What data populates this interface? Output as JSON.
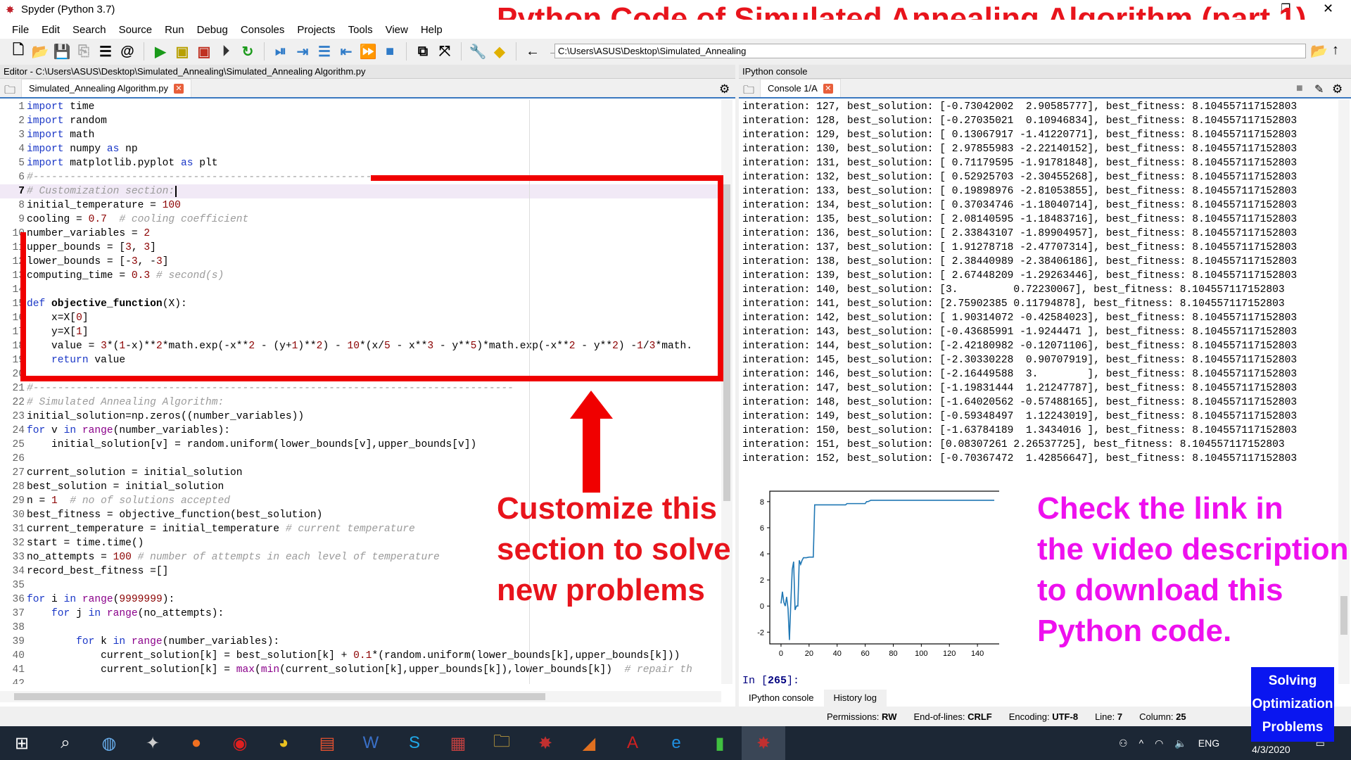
{
  "window": {
    "title": "Spyder (Python 3.7)"
  },
  "overlay": {
    "headline": "Python Code of Simulated Annealing Algorithm (part 1)",
    "customize_lines": [
      "Customize this",
      "section to solve",
      "new problems"
    ],
    "link_lines": [
      "Check the link in",
      "the video description",
      "to download this",
      "Python code."
    ],
    "badge_lines": [
      "Solving",
      "Optimization",
      "Problems"
    ],
    "colors": {
      "red": "#e8141c",
      "magenta": "#ee10ee",
      "badge": "#0a16f0"
    }
  },
  "menu": [
    "File",
    "Edit",
    "Search",
    "Source",
    "Run",
    "Debug",
    "Consoles",
    "Projects",
    "Tools",
    "View",
    "Help"
  ],
  "toolbar": {
    "path": "C:\\Users\\ASUS\\Desktop\\Simulated_Annealing"
  },
  "editor": {
    "header": "Editor - C:\\Users\\ASUS\\Desktop\\Simulated_Annealing\\Simulated_Annealing Algorithm.py",
    "tab": "Simulated_Annealing Algorithm.py",
    "current_line": 7,
    "lines": [
      [
        [
          "import",
          "k"
        ],
        [
          " time",
          ""
        ]
      ],
      [
        [
          "import",
          "k"
        ],
        [
          " random",
          ""
        ]
      ],
      [
        [
          "import",
          "k"
        ],
        [
          " math",
          ""
        ]
      ],
      [
        [
          "import",
          "k"
        ],
        [
          " numpy ",
          ""
        ],
        [
          "as",
          "k"
        ],
        [
          " np",
          ""
        ]
      ],
      [
        [
          "import",
          "k"
        ],
        [
          " matplotlib.pyplot ",
          ""
        ],
        [
          "as",
          "k"
        ],
        [
          " plt",
          ""
        ]
      ],
      [
        [
          "#------------------------------------------------------------------------------",
          "c"
        ]
      ],
      [
        [
          "# Customization section:",
          "c"
        ]
      ],
      [
        [
          "initial_temperature = ",
          ""
        ],
        [
          "100",
          "n"
        ]
      ],
      [
        [
          "cooling = ",
          ""
        ],
        [
          "0.7",
          "n"
        ],
        [
          "  # cooling coefficient",
          "c"
        ]
      ],
      [
        [
          "number_variables = ",
          ""
        ],
        [
          "2",
          "n"
        ]
      ],
      [
        [
          "upper_bounds = [",
          ""
        ],
        [
          "3",
          "n"
        ],
        [
          ", ",
          ""
        ],
        [
          "3",
          "n"
        ],
        [
          "]",
          ""
        ]
      ],
      [
        [
          "lower_bounds = [-",
          ""
        ],
        [
          "3",
          "n"
        ],
        [
          ", -",
          ""
        ],
        [
          "3",
          "n"
        ],
        [
          "]",
          ""
        ]
      ],
      [
        [
          "computing_time = ",
          ""
        ],
        [
          "0.3",
          "n"
        ],
        [
          " # second(s)",
          "c"
        ]
      ],
      [],
      [
        [
          "def",
          "k"
        ],
        [
          " ",
          ""
        ],
        [
          "objective_function",
          "f"
        ],
        [
          "(X):",
          ""
        ]
      ],
      [
        [
          "    x=X[",
          ""
        ],
        [
          "0",
          "n"
        ],
        [
          "]",
          ""
        ]
      ],
      [
        [
          "    y=X[",
          ""
        ],
        [
          "1",
          "n"
        ],
        [
          "]",
          ""
        ]
      ],
      [
        [
          "    value = ",
          ""
        ],
        [
          "3",
          "n"
        ],
        [
          "*(",
          ""
        ],
        [
          "1",
          "n"
        ],
        [
          "-x)**",
          ""
        ],
        [
          "2",
          "n"
        ],
        [
          "*math.exp(-x**",
          ""
        ],
        [
          "2",
          "n"
        ],
        [
          " - (y+",
          ""
        ],
        [
          "1",
          "n"
        ],
        [
          ")**",
          ""
        ],
        [
          "2",
          "n"
        ],
        [
          ") - ",
          ""
        ],
        [
          "10",
          "n"
        ],
        [
          "*(x/",
          ""
        ],
        [
          "5",
          "n"
        ],
        [
          " - x**",
          ""
        ],
        [
          "3",
          "n"
        ],
        [
          " - y**",
          ""
        ],
        [
          "5",
          "n"
        ],
        [
          ")*math.exp(-x**",
          ""
        ],
        [
          "2",
          "n"
        ],
        [
          " - y**",
          ""
        ],
        [
          "2",
          "n"
        ],
        [
          ") -",
          ""
        ],
        [
          "1",
          "n"
        ],
        [
          "/",
          ""
        ],
        [
          "3",
          "n"
        ],
        [
          "*math.",
          ""
        ]
      ],
      [
        [
          "    ",
          ""
        ],
        [
          "return",
          "k"
        ],
        [
          " value",
          ""
        ]
      ],
      [],
      [
        [
          "#------------------------------------------------------------------------------",
          "c"
        ]
      ],
      [
        [
          "# Simulated Annealing Algorithm:",
          "c"
        ]
      ],
      [
        [
          "initial_solution=np.zeros((number_variables))",
          ""
        ]
      ],
      [
        [
          "for",
          "k"
        ],
        [
          " v ",
          ""
        ],
        [
          "in",
          "k"
        ],
        [
          " ",
          ""
        ],
        [
          "range",
          "b"
        ],
        [
          "(number_variables):",
          ""
        ]
      ],
      [
        [
          "    initial_solution[v] = random.uniform(lower_bounds[v],upper_bounds[v])",
          ""
        ]
      ],
      [],
      [
        [
          "current_solution = initial_solution",
          ""
        ]
      ],
      [
        [
          "best_solution = initial_solution",
          ""
        ]
      ],
      [
        [
          "n = ",
          ""
        ],
        [
          "1",
          "n"
        ],
        [
          "  # no of solutions accepted",
          "c"
        ]
      ],
      [
        [
          "best_fitness = objective_function(best_solution)",
          ""
        ]
      ],
      [
        [
          "current_temperature = initial_temperature ",
          ""
        ],
        [
          "# current temperature",
          "c"
        ]
      ],
      [
        [
          "start = time.time()",
          ""
        ]
      ],
      [
        [
          "no_attempts = ",
          ""
        ],
        [
          "100",
          "n"
        ],
        [
          " # number of attempts in each level of temperature",
          "c"
        ]
      ],
      [
        [
          "record_best_fitness =[]",
          ""
        ]
      ],
      [],
      [
        [
          "for",
          "k"
        ],
        [
          " i ",
          ""
        ],
        [
          "in",
          "k"
        ],
        [
          " ",
          ""
        ],
        [
          "range",
          "b"
        ],
        [
          "(",
          ""
        ],
        [
          "9999999",
          "n"
        ],
        [
          "):",
          ""
        ]
      ],
      [
        [
          "    ",
          ""
        ],
        [
          "for",
          "k"
        ],
        [
          " j ",
          ""
        ],
        [
          "in",
          "k"
        ],
        [
          " ",
          ""
        ],
        [
          "range",
          "b"
        ],
        [
          "(no_attempts):",
          ""
        ]
      ],
      [],
      [
        [
          "        ",
          ""
        ],
        [
          "for",
          "k"
        ],
        [
          " k ",
          ""
        ],
        [
          "in",
          "k"
        ],
        [
          " ",
          ""
        ],
        [
          "range",
          "b"
        ],
        [
          "(number_variables):",
          ""
        ]
      ],
      [
        [
          "            current_solution[k] = best_solution[k] + ",
          ""
        ],
        [
          "0.1",
          "n"
        ],
        [
          "*(random.uniform(lower_bounds[k],upper_bounds[k]))",
          ""
        ]
      ],
      [
        [
          "            current_solution[k] = ",
          ""
        ],
        [
          "max",
          "b"
        ],
        [
          "(",
          ""
        ],
        [
          "min",
          "b"
        ],
        [
          "(current_solution[k],upper_bounds[k]),lower_bounds[k])  ",
          ""
        ],
        [
          "# repair th",
          "c"
        ]
      ],
      []
    ]
  },
  "console": {
    "header": "IPython console",
    "tab": "Console 1/A",
    "lines": [
      "interation: 127, best_solution: [-0.73042002  2.90585777], best_fitness: 8.104557117152803",
      "interation: 128, best_solution: [-0.27035021  0.10946834], best_fitness: 8.104557117152803",
      "interation: 129, best_solution: [ 0.13067917 -1.41220771], best_fitness: 8.104557117152803",
      "interation: 130, best_solution: [ 2.97855983 -2.22140152], best_fitness: 8.104557117152803",
      "interation: 131, best_solution: [ 0.71179595 -1.91781848], best_fitness: 8.104557117152803",
      "interation: 132, best_solution: [ 0.52925703 -2.30455268], best_fitness: 8.104557117152803",
      "interation: 133, best_solution: [ 0.19898976 -2.81053855], best_fitness: 8.104557117152803",
      "interation: 134, best_solution: [ 0.37034746 -1.18040714], best_fitness: 8.104557117152803",
      "interation: 135, best_solution: [ 2.08140595 -1.18483716], best_fitness: 8.104557117152803",
      "interation: 136, best_solution: [ 2.33843107 -1.89904957], best_fitness: 8.104557117152803",
      "interation: 137, best_solution: [ 1.91278718 -2.47707314], best_fitness: 8.104557117152803",
      "interation: 138, best_solution: [ 2.38440989 -2.38406186], best_fitness: 8.104557117152803",
      "interation: 139, best_solution: [ 2.67448209 -1.29263446], best_fitness: 8.104557117152803",
      "interation: 140, best_solution: [3.         0.72230067], best_fitness: 8.104557117152803",
      "interation: 141, best_solution: [2.75902385 0.11794878], best_fitness: 8.104557117152803",
      "interation: 142, best_solution: [ 1.90314072 -0.42584023], best_fitness: 8.104557117152803",
      "interation: 143, best_solution: [-0.43685991 -1.9244471 ], best_fitness: 8.104557117152803",
      "interation: 144, best_solution: [-2.42180982 -0.12071106], best_fitness: 8.104557117152803",
      "interation: 145, best_solution: [-2.30330228  0.90707919], best_fitness: 8.104557117152803",
      "interation: 146, best_solution: [-2.16449588  3.        ], best_fitness: 8.104557117152803",
      "interation: 147, best_solution: [-1.19831444  1.21247787], best_fitness: 8.104557117152803",
      "interation: 148, best_solution: [-1.64020562 -0.57488165], best_fitness: 8.104557117152803",
      "interation: 149, best_solution: [-0.59348497  1.12243019], best_fitness: 8.104557117152803",
      "interation: 150, best_solution: [-1.63784189  1.3434016 ], best_fitness: 8.104557117152803",
      "interation: 151, best_solution: [0.08307261 2.26537725], best_fitness: 8.104557117152803",
      "interation: 152, best_solution: [-0.70367472  1.42856647], best_fitness: 8.104557117152803"
    ],
    "prompt_in": "In [",
    "prompt_num": "265",
    "prompt_end": "]:",
    "bottom_tabs": [
      "IPython console",
      "History log"
    ]
  },
  "chart_data": {
    "type": "line",
    "x": [
      0,
      1,
      2,
      3,
      4,
      5,
      6,
      7,
      8,
      9,
      10,
      11,
      12,
      13,
      14,
      15,
      16,
      18,
      20,
      22,
      23,
      24,
      30,
      40,
      46,
      47,
      60,
      61,
      62,
      64,
      65,
      70,
      152
    ],
    "y": [
      0.2,
      1.1,
      0.3,
      0,
      0.7,
      -0.2,
      -2.6,
      0.3,
      2.8,
      3.4,
      -0.3,
      0,
      0,
      3.5,
      3.2,
      3.5,
      3.7,
      3.7,
      3.75,
      3.75,
      3.75,
      7.75,
      7.75,
      7.75,
      7.75,
      7.85,
      7.85,
      8.0,
      8.0,
      8.1,
      8.1,
      8.1,
      8.1
    ],
    "xlim": [
      -8,
      160
    ],
    "ylim": [
      -2.9,
      8.8
    ],
    "xticks": [
      "0",
      "20",
      "40",
      "60",
      "80",
      "100",
      "120",
      "140"
    ],
    "yticks": [
      "-2",
      "0",
      "2",
      "4",
      "6",
      "8"
    ],
    "grid": false,
    "color": "#1f77b4"
  },
  "status": {
    "permissions_label": "Permissions:",
    "permissions": "RW",
    "eol_label": "End-of-lines:",
    "eol": "CRLF",
    "encoding_label": "Encoding:",
    "encoding": "UTF-8",
    "line_label": "Line:",
    "line": "7",
    "column_label": "Column:",
    "column": "25"
  },
  "tray": {
    "lang": "ENG",
    "date": "4/3/2020"
  }
}
